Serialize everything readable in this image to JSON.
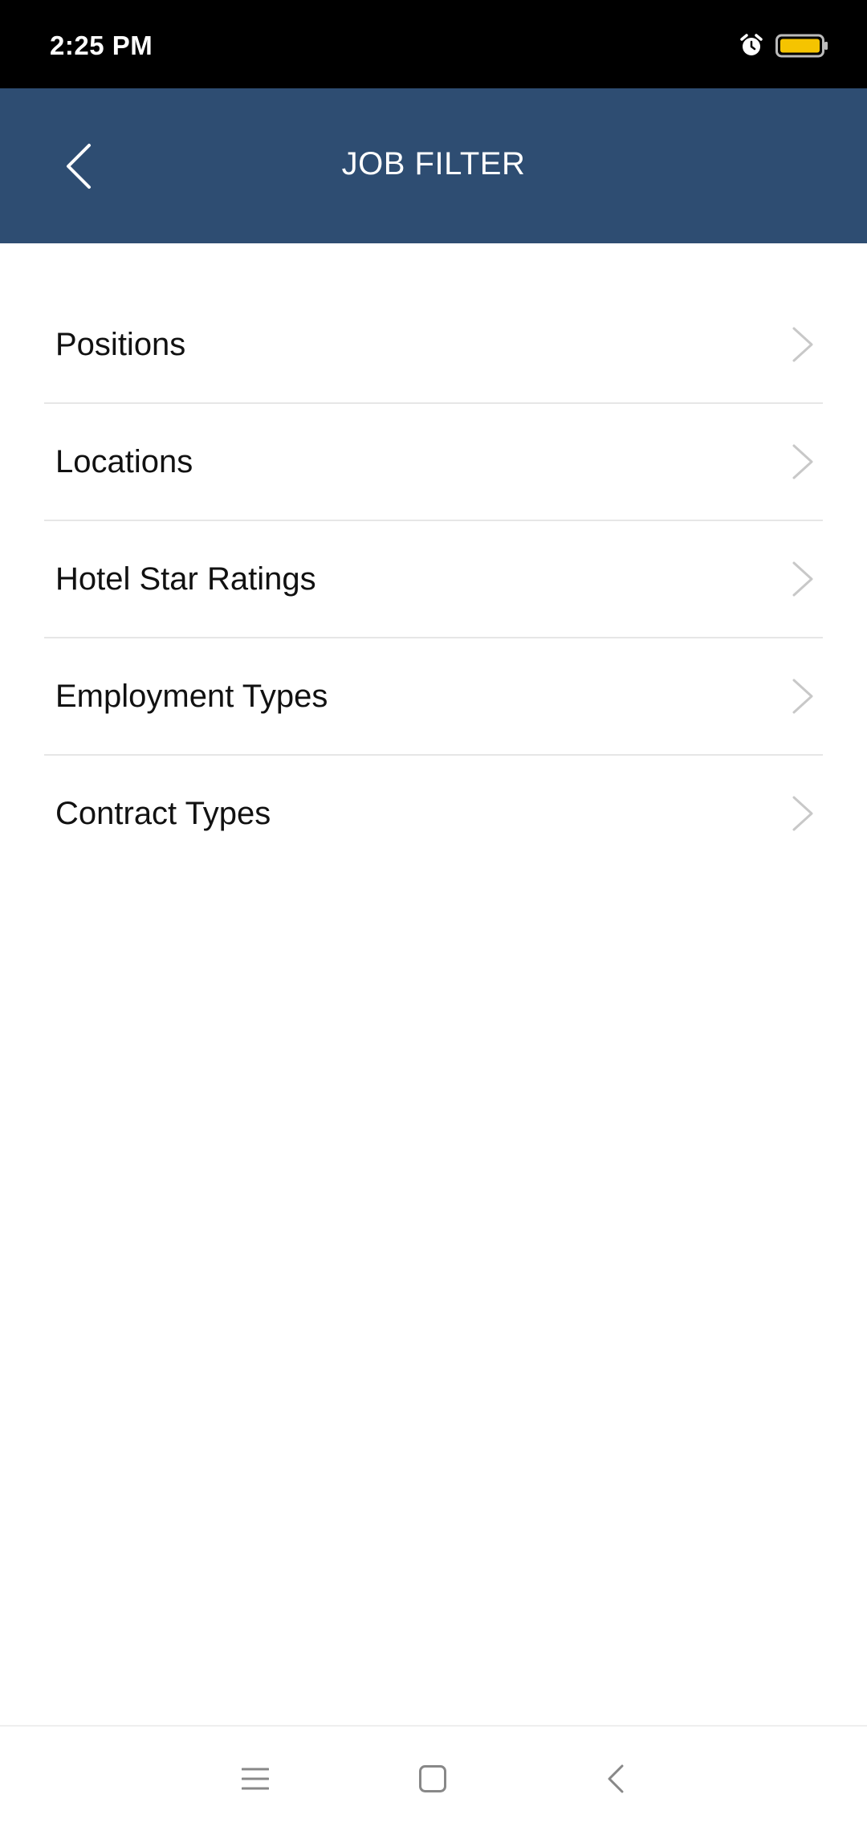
{
  "status_bar": {
    "time": "2:25 PM",
    "icons": [
      "alarm-icon",
      "battery-icon"
    ],
    "battery_color": "#f5c400"
  },
  "app_bar": {
    "title": "JOB FILTER",
    "back_icon": "chevron-left-icon",
    "background": "#2e4d72"
  },
  "filters": [
    {
      "label": "Positions"
    },
    {
      "label": "Locations"
    },
    {
      "label": "Hotel Star Ratings"
    },
    {
      "label": "Employment Types"
    },
    {
      "label": "Contract Types"
    }
  ],
  "nav_bar": {
    "icons": [
      "menu-icon",
      "home-icon",
      "back-icon"
    ]
  }
}
